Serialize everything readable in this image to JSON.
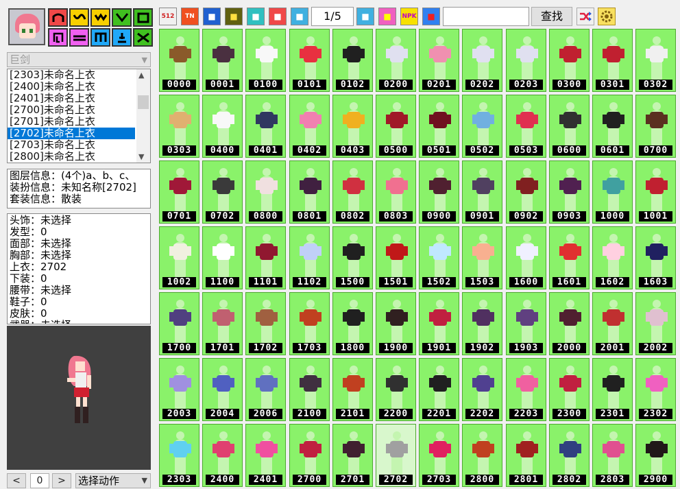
{
  "sidebar": {
    "slot_buttons": [
      {
        "icon": "hat-icon",
        "color": "#f04848"
      },
      {
        "icon": "hair-icon",
        "color": "#f8d000"
      },
      {
        "icon": "face-icon",
        "color": "#f8d000"
      },
      {
        "icon": "neck-icon",
        "color": "#40c020"
      },
      {
        "icon": "coat-icon",
        "color": "#40c020"
      },
      {
        "icon": "skin-icon",
        "color": "#f060f0"
      },
      {
        "icon": "belt-icon",
        "color": "#f060f0"
      },
      {
        "icon": "pants-icon",
        "color": "#20a8f8"
      },
      {
        "icon": "shoes-icon",
        "color": "#20a8f8"
      },
      {
        "icon": "weapon-icon",
        "color": "#40c020"
      }
    ],
    "weapon_select": "巨剑",
    "costume_list": [
      {
        "label": "[2303]未命名上衣",
        "selected": false
      },
      {
        "label": "[2400]未命名上衣",
        "selected": false
      },
      {
        "label": "[2401]未命名上衣",
        "selected": false
      },
      {
        "label": "[2700]未命名上衣",
        "selected": false
      },
      {
        "label": "[2701]未命名上衣",
        "selected": false
      },
      {
        "label": "[2702]未命名上衣",
        "selected": true
      },
      {
        "label": "[2703]未命名上衣",
        "selected": false
      },
      {
        "label": "[2800]未命名上衣",
        "selected": false
      }
    ],
    "layer_info": [
      "图层信息：(4个)a、b、c、",
      "装扮信息：未知名称[2702]",
      "套装信息：散装"
    ],
    "equip_info": [
      "头饰：未选择",
      "发型：0",
      "面部：未选择",
      "胸部：未选择",
      "上衣：2702",
      "下装：0",
      "腰带：未选择",
      "鞋子：0",
      "皮肤：0",
      "武器：未选择"
    ],
    "nav": {
      "prev": "<",
      "frame": "0",
      "next": ">",
      "action": "选择动作"
    }
  },
  "toolbar": {
    "buttons": [
      {
        "icon": "resolution-icon",
        "label": "512",
        "bg": "#f0f0f0",
        "fg": "#d02020"
      },
      {
        "icon": "tn-icon",
        "label": "TN",
        "bg": "#f05020",
        "fg": "#ffffff"
      },
      {
        "icon": "panel-icon",
        "label": "",
        "bg": "#2060d0",
        "fg": "#ffffff"
      },
      {
        "icon": "film-icon",
        "label": "",
        "bg": "#606010",
        "fg": "#ffe040"
      },
      {
        "icon": "shirt-icon",
        "label": "",
        "bg": "#30c0c0",
        "fg": "#ffffff"
      },
      {
        "icon": "reset-icon",
        "label": "",
        "bg": "#f04848",
        "fg": "#ffffff"
      },
      {
        "icon": "back-icon",
        "label": "",
        "bg": "#40b0e0",
        "fg": "#ffffff"
      }
    ],
    "page": "1/5",
    "buttons_right": [
      {
        "icon": "next-page-icon",
        "label": "",
        "bg": "#40b0e0",
        "fg": "#ffffff"
      },
      {
        "icon": "gift-icon",
        "label": "",
        "bg": "#f060c0",
        "fg": "#ffff00"
      },
      {
        "icon": "npk-icon",
        "label": "NPK",
        "bg": "#f8e000",
        "fg": "#c000c0"
      },
      {
        "icon": "globe-icon",
        "label": "",
        "bg": "#3080f0",
        "fg": "#f02020"
      }
    ],
    "search_placeholder": "",
    "search_label": "查找",
    "shuffle_icon": "shuffle-icon",
    "settings_icon": "gear-icon"
  },
  "grid": {
    "selected_code": "2702",
    "items": [
      {
        "code": "0000",
        "c": "#8a5a2a"
      },
      {
        "code": "0001",
        "c": "#4a3040"
      },
      {
        "code": "0100",
        "c": "#f8f8f8"
      },
      {
        "code": "0101",
        "c": "#e83040"
      },
      {
        "code": "0102",
        "c": "#202020"
      },
      {
        "code": "0200",
        "c": "#e0e0f0"
      },
      {
        "code": "0201",
        "c": "#f090b0"
      },
      {
        "code": "0202",
        "c": "#e0e0f0"
      },
      {
        "code": "0203",
        "c": "#e0e0f0"
      },
      {
        "code": "0300",
        "c": "#c02030"
      },
      {
        "code": "0301",
        "c": "#c02030"
      },
      {
        "code": "0302",
        "c": "#f0f0f0"
      },
      {
        "code": "0303",
        "c": "#e0b070"
      },
      {
        "code": "0400",
        "c": "#f8f8f8"
      },
      {
        "code": "0401",
        "c": "#303860"
      },
      {
        "code": "0402",
        "c": "#f080b0"
      },
      {
        "code": "0403",
        "c": "#f0b020"
      },
      {
        "code": "0500",
        "c": "#a01828"
      },
      {
        "code": "0501",
        "c": "#701020"
      },
      {
        "code": "0502",
        "c": "#70b0e0"
      },
      {
        "code": "0503",
        "c": "#e03050"
      },
      {
        "code": "0600",
        "c": "#303030"
      },
      {
        "code": "0601",
        "c": "#202020"
      },
      {
        "code": "0700",
        "c": "#5a3020"
      },
      {
        "code": "0701",
        "c": "#a01838"
      },
      {
        "code": "0702",
        "c": "#3a3a3a"
      },
      {
        "code": "0800",
        "c": "#f0e0e0"
      },
      {
        "code": "0801",
        "c": "#402040"
      },
      {
        "code": "0802",
        "c": "#d03040"
      },
      {
        "code": "0803",
        "c": "#f07090"
      },
      {
        "code": "0900",
        "c": "#502030"
      },
      {
        "code": "0901",
        "c": "#504060"
      },
      {
        "code": "0902",
        "c": "#802020"
      },
      {
        "code": "0903",
        "c": "#502050"
      },
      {
        "code": "1000",
        "c": "#40a0a0"
      },
      {
        "code": "1001",
        "c": "#c02030"
      },
      {
        "code": "1002",
        "c": "#f0f0e0"
      },
      {
        "code": "1100",
        "c": "#ffffff"
      },
      {
        "code": "1101",
        "c": "#901830"
      },
      {
        "code": "1102",
        "c": "#c0d0f8"
      },
      {
        "code": "1500",
        "c": "#202020"
      },
      {
        "code": "1501",
        "c": "#c01818"
      },
      {
        "code": "1502",
        "c": "#c0e8ff"
      },
      {
        "code": "1503",
        "c": "#f8b090"
      },
      {
        "code": "1600",
        "c": "#f0f0ff"
      },
      {
        "code": "1601",
        "c": "#e03030"
      },
      {
        "code": "1602",
        "c": "#ffd0e0"
      },
      {
        "code": "1603",
        "c": "#202060"
      },
      {
        "code": "1700",
        "c": "#504080"
      },
      {
        "code": "1701",
        "c": "#c06070"
      },
      {
        "code": "1702",
        "c": "#a06040"
      },
      {
        "code": "1703",
        "c": "#c04020"
      },
      {
        "code": "1800",
        "c": "#202020"
      },
      {
        "code": "1900",
        "c": "#302020"
      },
      {
        "code": "1901",
        "c": "#c02040"
      },
      {
        "code": "1902",
        "c": "#503060"
      },
      {
        "code": "1903",
        "c": "#604080"
      },
      {
        "code": "2000",
        "c": "#502030"
      },
      {
        "code": "2001",
        "c": "#c03030"
      },
      {
        "code": "2002",
        "c": "#e0c0d0"
      },
      {
        "code": "2003",
        "c": "#a090e0"
      },
      {
        "code": "2004",
        "c": "#5060c0"
      },
      {
        "code": "2006",
        "c": "#6070c0"
      },
      {
        "code": "2100",
        "c": "#403040"
      },
      {
        "code": "2101",
        "c": "#c04020"
      },
      {
        "code": "2200",
        "c": "#303030"
      },
      {
        "code": "2201",
        "c": "#202020"
      },
      {
        "code": "2202",
        "c": "#504090"
      },
      {
        "code": "2203",
        "c": "#f060a0"
      },
      {
        "code": "2300",
        "c": "#c02040"
      },
      {
        "code": "2301",
        "c": "#202020"
      },
      {
        "code": "2302",
        "c": "#f060c0"
      },
      {
        "code": "2303",
        "c": "#60d0f0"
      },
      {
        "code": "2400",
        "c": "#e04070"
      },
      {
        "code": "2401",
        "c": "#f050a0"
      },
      {
        "code": "2700",
        "c": "#c02040"
      },
      {
        "code": "2701",
        "c": "#402030"
      },
      {
        "code": "2702",
        "c": "#a0a0a0"
      },
      {
        "code": "2703",
        "c": "#e02060"
      },
      {
        "code": "2800",
        "c": "#c04020"
      },
      {
        "code": "2801",
        "c": "#a02020"
      },
      {
        "code": "2802",
        "c": "#304080"
      },
      {
        "code": "2803",
        "c": "#e05090"
      },
      {
        "code": "2900",
        "c": "#201818"
      }
    ]
  }
}
